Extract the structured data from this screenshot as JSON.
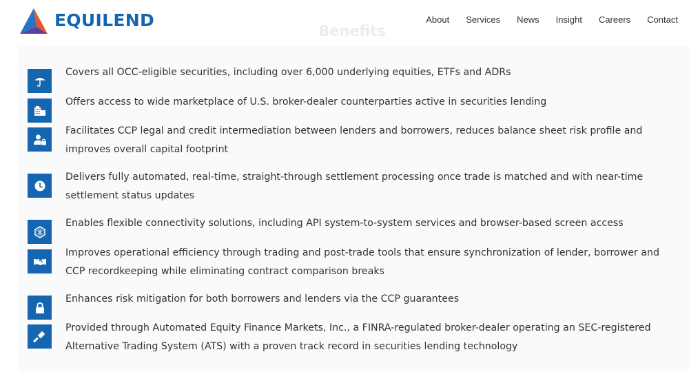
{
  "header": {
    "logo_text": "EQUILEND",
    "nav": [
      "About",
      "Services",
      "News",
      "Insight",
      "Careers",
      "Contact"
    ]
  },
  "section": {
    "title": "Benefits"
  },
  "colors": {
    "brand_blue": "#1566b0",
    "logo_orange": "#e2592a",
    "logo_purple": "#5a3ea0",
    "text": "#333333",
    "panel_bg": "#fafafa"
  },
  "benefits": [
    {
      "icon": "umbrella-icon",
      "text": "Covers all OCC-eligible securities, including over 6,000 underlying equities, ETFs and ADRs"
    },
    {
      "icon": "building-icon",
      "text": "Offers access to wide marketplace of U.S. broker-dealer counterparties active in securities lending"
    },
    {
      "icon": "user-lock-icon",
      "text": "Facilitates CCP legal and credit intermediation between lenders and borrowers, reduces balance sheet risk profile and improves overall capital footprint"
    },
    {
      "icon": "clock-icon",
      "text": "Delivers fully automated, real-time, straight-through settlement processing once trade is matched and with near-time settlement status updates"
    },
    {
      "icon": "network-icon",
      "text": "Enables flexible connectivity solutions, including API system-to-system services and browser-based screen access"
    },
    {
      "icon": "handshake-icon",
      "text": "Improves operational efficiency through trading and post-trade tools that ensure synchronization of lender, borrower and CCP recordkeeping while eliminating contract comparison breaks"
    },
    {
      "icon": "lock-icon",
      "text": "Enhances risk mitigation for both borrowers and lenders via the CCP guarantees"
    },
    {
      "icon": "gavel-icon",
      "text": "Provided through Automated Equity Finance Markets, Inc., a FINRA-regulated broker-dealer operating an SEC-registered Alternative Trading System (ATS) with a proven track record in securities lending technology"
    }
  ]
}
